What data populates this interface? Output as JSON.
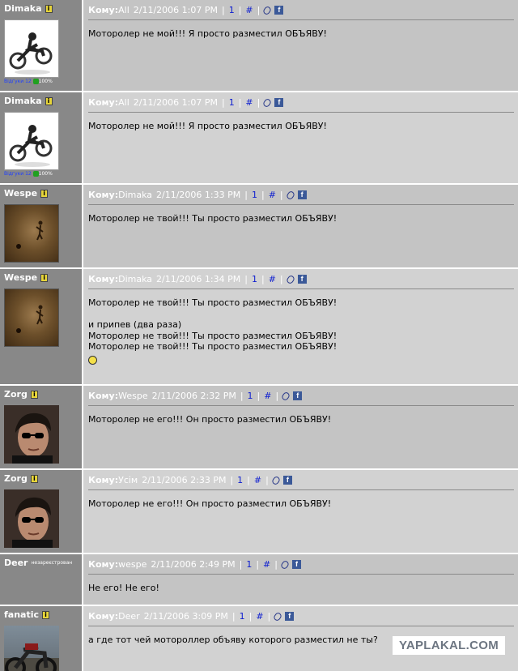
{
  "posts": [
    {
      "author": "Dimaka",
      "avatar": "motorcycle-jump",
      "rating": {
        "label": "Відгуки",
        "count": "12",
        "percent": "100%"
      },
      "to_label": "Кому:",
      "to": "All",
      "date": "2/11/2006 1:07 PM",
      "num": "1",
      "hash": "#",
      "lines": [
        "Моторолер не мой!!! Я просто разместил ОБЪЯВУ!"
      ]
    },
    {
      "author": "Dimaka",
      "avatar": "motorcycle-jump",
      "rating": {
        "label": "Відгуки",
        "count": "12",
        "percent": "100%"
      },
      "to_label": "Кому:",
      "to": "All",
      "date": "2/11/2006 1:07 PM",
      "num": "1",
      "hash": "#",
      "lines": [
        "Моторолер не мой!!! Я просто разместил ОБЪЯВУ!"
      ]
    },
    {
      "author": "Wespe",
      "avatar": "sepia-runner",
      "to_label": "Кому:",
      "to": "Dimaka",
      "date": "2/11/2006 1:33 PM",
      "num": "1",
      "hash": "#",
      "lines": [
        "Моторолер не твой!!! Ты просто разместил ОБЪЯВУ!"
      ]
    },
    {
      "author": "Wespe",
      "avatar": "sepia-runner",
      "to_label": "Кому:",
      "to": "Dimaka",
      "date": "2/11/2006 1:34 PM",
      "num": "1",
      "hash": "#",
      "lines": [
        "Моторолер не твой!!! Ты просто разместил ОБЪЯВУ!",
        "",
        "и припев (два раза)",
        "Моторолер не твой!!! Ты просто разместил ОБЪЯВУ!",
        "Моторолер не твой!!! Ты просто разместил ОБЪЯВУ!"
      ],
      "smiley": "laughing-smiley"
    },
    {
      "author": "Zorg",
      "avatar": "man-sunglasses",
      "to_label": "Кому:",
      "to": "Wespe",
      "date": "2/11/2006 2:32 PM",
      "num": "1",
      "hash": "#",
      "lines": [
        "Моторолер не его!!! Он просто разместил ОБЪЯВУ!"
      ]
    },
    {
      "author": "Zorg",
      "avatar": "man-sunglasses",
      "to_label": "Кому:",
      "to": "Усім",
      "date": "2/11/2006 2:33 PM",
      "num": "1",
      "hash": "#",
      "lines": [
        "Моторолер не его!!! Он просто разместил ОБЪЯВУ!"
      ]
    },
    {
      "author": "Deer",
      "unregistered": "незареєстрован",
      "to_label": "Кому:",
      "to": "wespe",
      "date": "2/11/2006 2:49 PM",
      "num": "1",
      "hash": "#",
      "lines": [
        "Не его! Не его!"
      ]
    },
    {
      "author": "fanatic",
      "avatar": "motorcycle-photo",
      "to_label": "Кому:",
      "to": "Deer",
      "date": "2/11/2006 3:09 PM",
      "num": "1",
      "hash": "#",
      "lines": [
        "а где тот чей мотороллер объяву которого разместил не ты?"
      ]
    }
  ],
  "watermark": "YAPLAKAL.COM"
}
